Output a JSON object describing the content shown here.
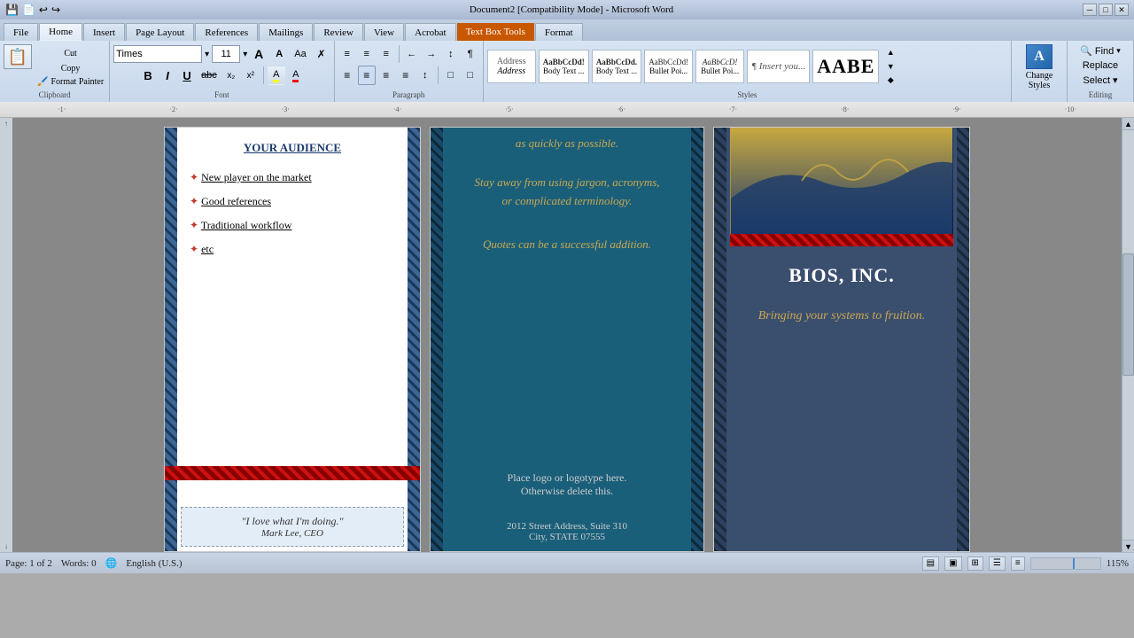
{
  "titlebar": {
    "title": "Document2 [Compatibility Mode] - Microsoft Word",
    "minimize": "─",
    "maximize": "□",
    "close": "✕"
  },
  "tabs": {
    "file": "File",
    "home": "Home",
    "insert": "Insert",
    "page_layout": "Page Layout",
    "references": "References",
    "mailings": "Mailings",
    "review": "Review",
    "view": "View",
    "acrobat": "Acrobat",
    "format": "Format",
    "textbox": "Text Box Tools"
  },
  "clipboard": {
    "paste_label": "Paste",
    "cut_label": "Cut",
    "copy_label": "Copy",
    "format_painter_label": "Format Painter",
    "section_label": "Clipboard"
  },
  "font": {
    "name": "Times",
    "size": "11",
    "grow_label": "A",
    "shrink_label": "A",
    "change_case_label": "Aa",
    "clear_label": "✗",
    "bold_label": "B",
    "italic_label": "I",
    "underline_label": "U",
    "strikethrough_label": "abc",
    "subscript_label": "x₂",
    "superscript_label": "x²",
    "highlight_label": "A",
    "color_label": "A",
    "section_label": "Font"
  },
  "paragraph": {
    "bullets_label": "≡",
    "numbering_label": "≡",
    "multilevel_label": "≡",
    "decrease_indent_label": "←",
    "increase_indent_label": "→",
    "sort_label": "↕",
    "show_hide_label": "¶",
    "align_left_label": "≡",
    "align_center_label": "≡",
    "align_right_label": "≡",
    "justify_label": "≡",
    "line_spacing_label": "↕",
    "shading_label": "□",
    "border_label": "□",
    "section_label": "Paragraph"
  },
  "styles": {
    "address_label": "Address",
    "body_text1_label": "Body Text ...",
    "body_text2_label": "Body Text ...",
    "bullet_point1_label": "Bullet Poi...",
    "bullet_point2_label": "Bullet Poi...",
    "insert_label": "¶ Insert you...",
    "large_style_label": "AABE",
    "section_label": "Styles"
  },
  "change_styles": {
    "label": "Change Styles",
    "icon": "A"
  },
  "editing": {
    "find_label": "Find",
    "replace_label": "Replace",
    "select_label": "Select ▾",
    "section_label": "Editing"
  },
  "ruler": {
    "numbers": [
      "1",
      "2",
      "3",
      "4",
      "5",
      "6",
      "7",
      "8",
      "9",
      "10"
    ]
  },
  "left_panel": {
    "heading": "YOUR AUDIENCE",
    "bullet1": "New player on the market",
    "bullet2": "Good references",
    "bullet3": "Traditional workflow",
    "bullet4": "etc",
    "quote": "\"I love what I'm doing.\"",
    "quote_attr": "Mark Lee, CEO"
  },
  "middle_panel": {
    "text1": "as quickly as possible.",
    "text2": "Stay away from using jargon, acronyms,",
    "text3": "or complicated terminology.",
    "text4": "Quotes can be a successful addition.",
    "logo_line1": "Place logo  or logotype here.",
    "logo_line2": "Otherwise delete this.",
    "address1": "2012 Street Address,  Suite 310",
    "address2": "City, STATE 07555"
  },
  "right_panel": {
    "company_name": "BIOS, INC.",
    "tagline": "Bringing your systems to fruition."
  },
  "status_bar": {
    "page_info": "Page: 1 of 2",
    "words": "Words: 0",
    "language": "English (U.S.)",
    "zoom": "115%"
  }
}
